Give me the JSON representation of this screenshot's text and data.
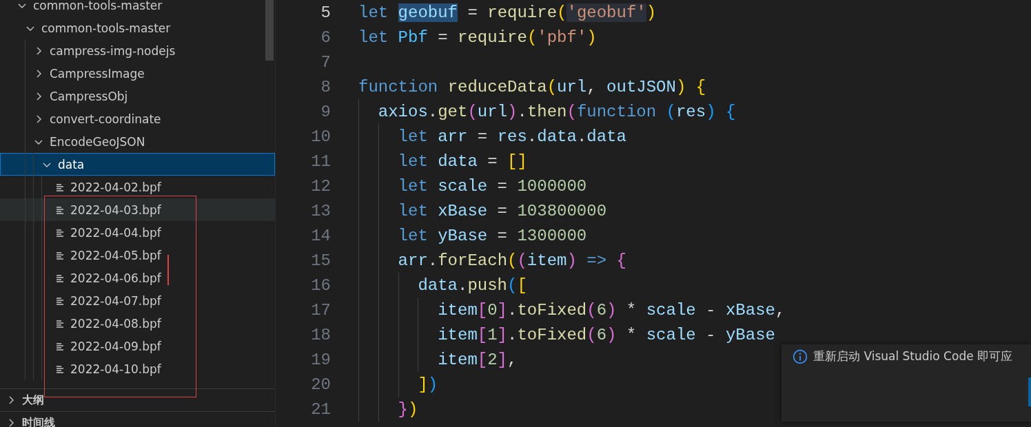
{
  "explorer": {
    "tree": [
      {
        "label": "common-tools-master",
        "expanded": true,
        "children": [
          {
            "label": "common-tools-master",
            "expanded": true,
            "children": [
              {
                "label": "campress-img-nodejs",
                "expanded": false
              },
              {
                "label": "CampressImage",
                "expanded": false
              },
              {
                "label": "CampressObj",
                "expanded": false
              },
              {
                "label": "convert-coordinate",
                "expanded": false
              },
              {
                "label": "EncodeGeoJSON",
                "expanded": true,
                "children": [
                  {
                    "label": "data",
                    "expanded": true,
                    "selected": true,
                    "children": [
                      {
                        "label": "2022-04-02.bpf",
                        "kind": "file",
                        "hovered": false
                      },
                      {
                        "label": "2022-04-03.bpf",
                        "kind": "file",
                        "hovered": true
                      },
                      {
                        "label": "2022-04-04.bpf",
                        "kind": "file",
                        "hovered": false
                      },
                      {
                        "label": "2022-04-05.bpf",
                        "kind": "file",
                        "hovered": false
                      },
                      {
                        "label": "2022-04-06.bpf",
                        "kind": "file",
                        "hovered": false
                      },
                      {
                        "label": "2022-04-07.bpf",
                        "kind": "file",
                        "hovered": false
                      },
                      {
                        "label": "2022-04-08.bpf",
                        "kind": "file",
                        "hovered": false
                      },
                      {
                        "label": "2022-04-09.bpf",
                        "kind": "file",
                        "hovered": false
                      },
                      {
                        "label": "2022-04-10.bpf",
                        "kind": "file",
                        "hovered": false
                      }
                    ]
                  }
                ]
              }
            ]
          }
        ]
      }
    ]
  },
  "panels": [
    {
      "label": "大纲",
      "expanded": false
    },
    {
      "label": "时间线",
      "expanded": false
    }
  ],
  "editor": {
    "lines": [
      {
        "number": "5",
        "active": true,
        "tokens": [
          {
            "t": "let ",
            "kind": "keyword"
          },
          {
            "t": "geobuf",
            "kind": "variable",
            "selected": true
          },
          {
            "t": " = "
          },
          {
            "t": "require",
            "kind": "function"
          },
          {
            "t": "(",
            "kind": "bracket1"
          },
          {
            "t": "'geobuf'",
            "kind": "string",
            "highlighted": true
          },
          {
            "t": ")",
            "kind": "bracket1"
          }
        ]
      },
      {
        "number": "6",
        "active": false,
        "tokens": [
          {
            "t": "let ",
            "kind": "keyword"
          },
          {
            "t": "Pbf",
            "kind": "constant"
          },
          {
            "t": " = "
          },
          {
            "t": "require",
            "kind": "function"
          },
          {
            "t": "(",
            "kind": "bracket1"
          },
          {
            "t": "'pbf'",
            "kind": "string"
          },
          {
            "t": ")",
            "kind": "bracket1"
          }
        ]
      },
      {
        "number": "7",
        "active": false
      },
      {
        "number": "8",
        "active": false,
        "tokens": [
          {
            "t": "function ",
            "kind": "keyword"
          },
          {
            "t": "reduceData",
            "kind": "function"
          },
          {
            "t": "(",
            "kind": "bracket1"
          },
          {
            "t": "url",
            "kind": "variable"
          },
          {
            "t": ", "
          },
          {
            "t": "outJSON",
            "kind": "variable"
          },
          {
            "t": ")",
            "kind": "bracket1"
          },
          {
            "t": " {",
            "kind": "bracket1"
          }
        ]
      },
      {
        "number": "9",
        "active": false,
        "tokens": [
          {
            "t": "  axios",
            "kind": "variable"
          },
          {
            "t": "."
          },
          {
            "t": "get",
            "kind": "function"
          },
          {
            "t": "(",
            "kind": "bracket2"
          },
          {
            "t": "url",
            "kind": "variable"
          },
          {
            "t": ")",
            "kind": "bracket2"
          },
          {
            "t": "."
          },
          {
            "t": "then",
            "kind": "function"
          },
          {
            "t": "(",
            "kind": "bracket2"
          },
          {
            "t": "function ",
            "kind": "keyword"
          },
          {
            "t": "(",
            "kind": "bracket3"
          },
          {
            "t": "res",
            "kind": "variable"
          },
          {
            "t": ")",
            "kind": "bracket3"
          },
          {
            "t": " {",
            "kind": "bracket3"
          }
        ]
      },
      {
        "number": "10",
        "active": false,
        "tokens": [
          {
            "t": "    let ",
            "kind": "keyword"
          },
          {
            "t": "arr",
            "kind": "variable"
          },
          {
            "t": " = "
          },
          {
            "t": "res",
            "kind": "variable"
          },
          {
            "t": "."
          },
          {
            "t": "data",
            "kind": "variable"
          },
          {
            "t": "."
          },
          {
            "t": "data",
            "kind": "variable"
          }
        ]
      },
      {
        "number": "11",
        "active": false,
        "tokens": [
          {
            "t": "    let ",
            "kind": "keyword"
          },
          {
            "t": "data",
            "kind": "variable"
          },
          {
            "t": " = "
          },
          {
            "t": "[]",
            "kind": "bracket1"
          }
        ]
      },
      {
        "number": "12",
        "active": false,
        "tokens": [
          {
            "t": "    let ",
            "kind": "keyword"
          },
          {
            "t": "scale",
            "kind": "variable"
          },
          {
            "t": " = "
          },
          {
            "t": "1000000",
            "kind": "number"
          }
        ]
      },
      {
        "number": "13",
        "active": false,
        "tokens": [
          {
            "t": "    let ",
            "kind": "keyword"
          },
          {
            "t": "xBase",
            "kind": "variable"
          },
          {
            "t": " = "
          },
          {
            "t": "103800000",
            "kind": "number"
          }
        ]
      },
      {
        "number": "14",
        "active": false,
        "tokens": [
          {
            "t": "    let ",
            "kind": "keyword"
          },
          {
            "t": "yBase",
            "kind": "variable"
          },
          {
            "t": " = "
          },
          {
            "t": "1300000",
            "kind": "number"
          }
        ]
      },
      {
        "number": "15",
        "active": false,
        "tokens": [
          {
            "t": "    arr",
            "kind": "variable"
          },
          {
            "t": "."
          },
          {
            "t": "forEach",
            "kind": "function"
          },
          {
            "t": "(",
            "kind": "bracket1"
          },
          {
            "t": "(",
            "kind": "bracket2"
          },
          {
            "t": "item",
            "kind": "variable"
          },
          {
            "t": ")",
            "kind": "bracket2"
          },
          {
            "t": " => ",
            "kind": "keyword"
          },
          {
            "t": "{",
            "kind": "bracket2"
          }
        ]
      },
      {
        "number": "16",
        "active": false,
        "tokens": [
          {
            "t": "      data",
            "kind": "variable"
          },
          {
            "t": "."
          },
          {
            "t": "push",
            "kind": "function"
          },
          {
            "t": "(",
            "kind": "bracket3"
          },
          {
            "t": "[",
            "kind": "bracket1"
          }
        ]
      },
      {
        "number": "17",
        "active": false,
        "tokens": [
          {
            "t": "        item",
            "kind": "variable"
          },
          {
            "t": "[",
            "kind": "bracket2"
          },
          {
            "t": "0",
            "kind": "number"
          },
          {
            "t": "]",
            "kind": "bracket2"
          },
          {
            "t": "."
          },
          {
            "t": "toFixed",
            "kind": "function"
          },
          {
            "t": "(",
            "kind": "bracket2"
          },
          {
            "t": "6",
            "kind": "number"
          },
          {
            "t": ")",
            "kind": "bracket2"
          },
          {
            "t": " * "
          },
          {
            "t": "scale",
            "kind": "variable"
          },
          {
            "t": " - "
          },
          {
            "t": "xBase",
            "kind": "variable"
          },
          {
            "t": ","
          }
        ]
      },
      {
        "number": "18",
        "active": false,
        "tokens": [
          {
            "t": "        item",
            "kind": "variable"
          },
          {
            "t": "[",
            "kind": "bracket2"
          },
          {
            "t": "1",
            "kind": "number"
          },
          {
            "t": "]",
            "kind": "bracket2"
          },
          {
            "t": "."
          },
          {
            "t": "toFixed",
            "kind": "function"
          },
          {
            "t": "(",
            "kind": "bracket2"
          },
          {
            "t": "6",
            "kind": "number"
          },
          {
            "t": ")",
            "kind": "bracket2"
          },
          {
            "t": " * "
          },
          {
            "t": "scale",
            "kind": "variable"
          },
          {
            "t": " - "
          },
          {
            "t": "yBase",
            "kind": "variable"
          }
        ]
      },
      {
        "number": "19",
        "active": false,
        "tokens": [
          {
            "t": "        item",
            "kind": "variable"
          },
          {
            "t": "[",
            "kind": "bracket2"
          },
          {
            "t": "2",
            "kind": "number"
          },
          {
            "t": "]",
            "kind": "bracket2"
          },
          {
            "t": ","
          }
        ]
      },
      {
        "number": "20",
        "active": false,
        "tokens": [
          {
            "t": "      ]",
            "kind": "bracket1"
          },
          {
            "t": ")",
            "kind": "bracket3"
          }
        ]
      },
      {
        "number": "21",
        "active": false,
        "tokens": [
          {
            "t": "    }",
            "kind": "bracket2"
          },
          {
            "t": ")",
            "kind": "bracket1"
          }
        ]
      }
    ]
  },
  "notification": {
    "message": "重新启动 Visual Studio Code 即可应"
  }
}
